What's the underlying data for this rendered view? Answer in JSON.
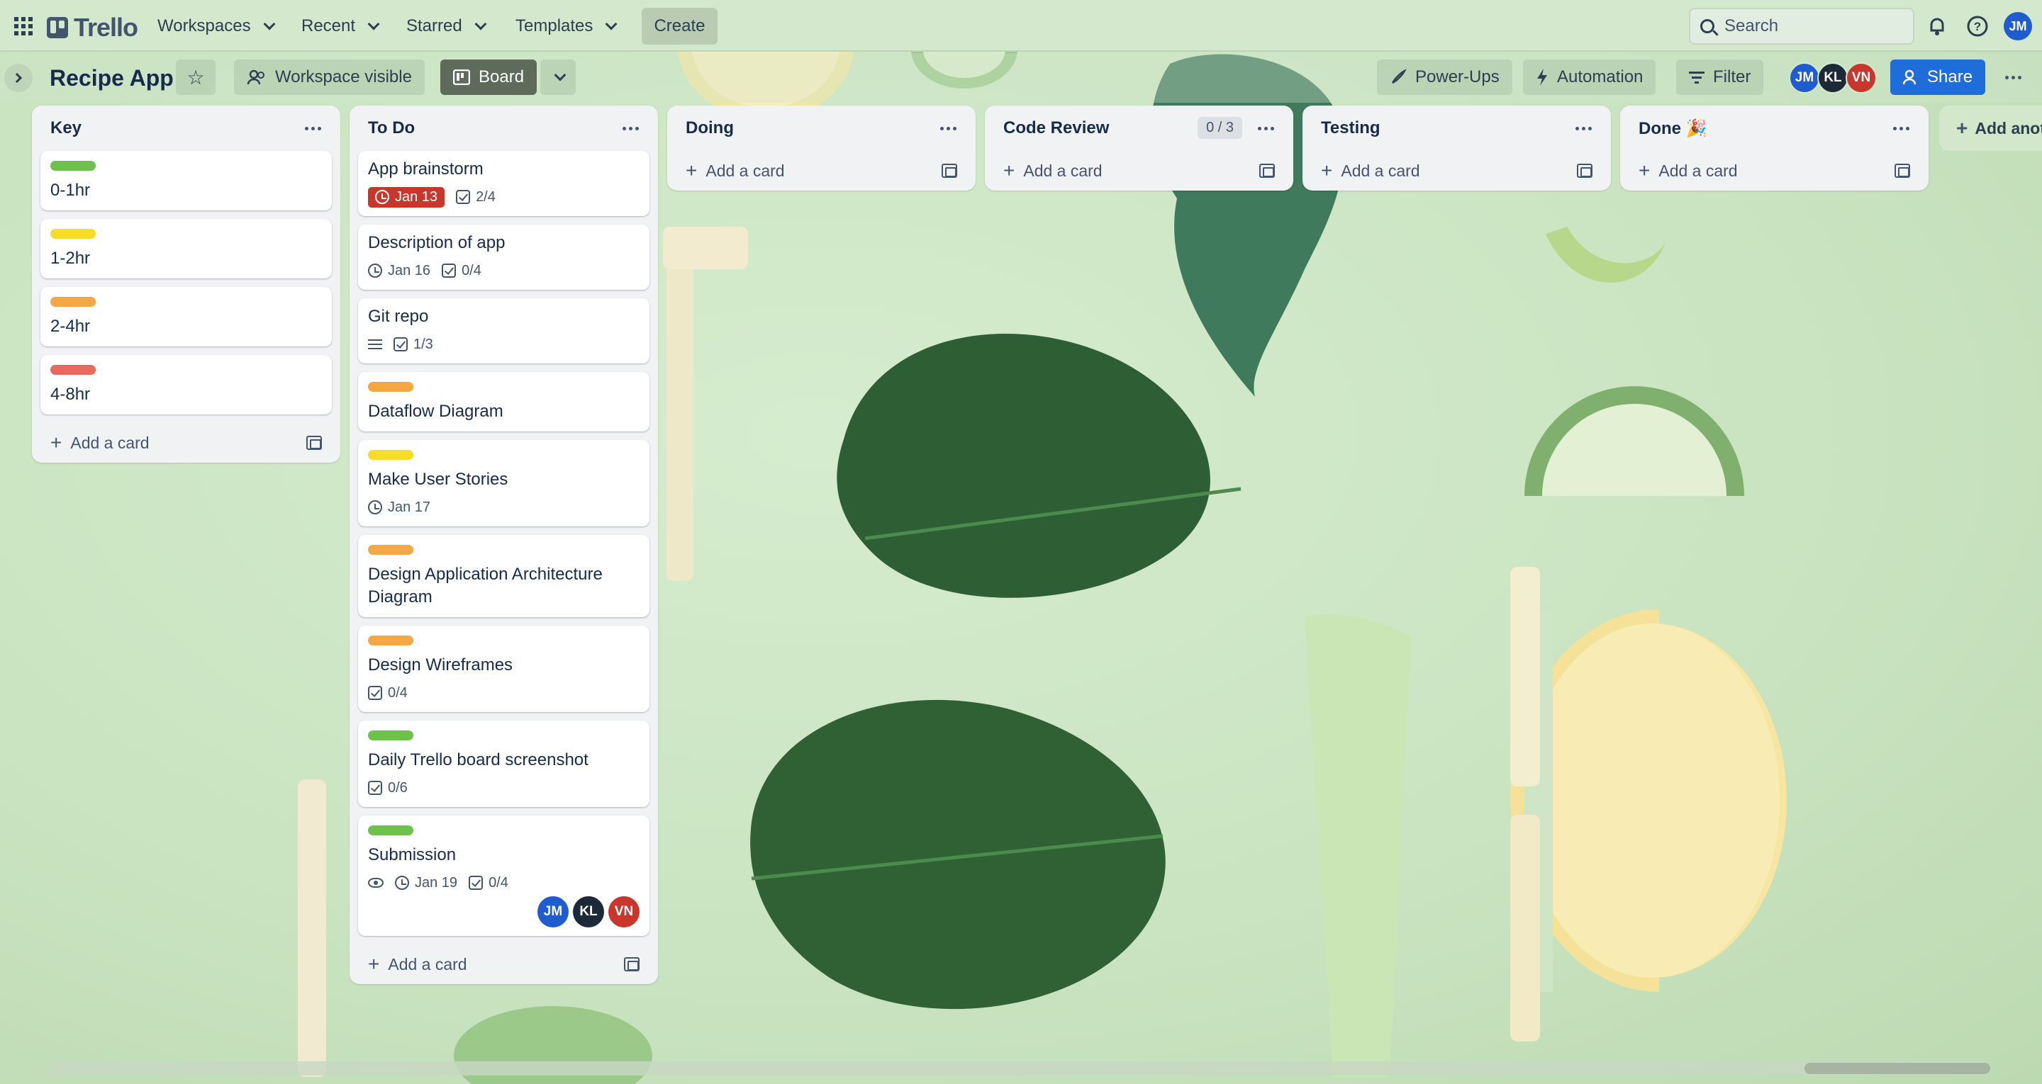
{
  "nav": {
    "logo": "Trello",
    "menus": [
      "Workspaces",
      "Recent",
      "Starred",
      "Templates"
    ],
    "create": "Create",
    "search_placeholder": "Search",
    "user_initials": "JM"
  },
  "board": {
    "title": "Recipe App",
    "visibility": "Workspace visible",
    "view": "Board",
    "power_ups": "Power-Ups",
    "automation": "Automation",
    "filter": "Filter",
    "share": "Share",
    "members": [
      "JM",
      "KL",
      "VN"
    ]
  },
  "lists": [
    {
      "title": "Key",
      "cards": [
        {
          "label_color": "#6cc24a",
          "title": "0-1hr"
        },
        {
          "label_color": "#f5dd29",
          "title": "1-2hr"
        },
        {
          "label_color": "#f4a742",
          "title": "2-4hr"
        },
        {
          "label_color": "#e86a5e",
          "title": "4-8hr"
        }
      ],
      "add_card": "Add a card"
    },
    {
      "title": "To Do",
      "cards": [
        {
          "title": "App brainstorm",
          "due": "Jan 13",
          "due_overdue": true,
          "checklist": "2/4"
        },
        {
          "title": "Description of app",
          "due": "Jan 16",
          "checklist": "0/4"
        },
        {
          "title": "Git repo",
          "has_description": true,
          "checklist": "1/3"
        },
        {
          "label_color": "#f4a742",
          "title": "Dataflow Diagram"
        },
        {
          "label_color": "#f5dd29",
          "title": "Make User Stories",
          "due": "Jan 17"
        },
        {
          "label_color": "#f4a742",
          "title": "Design Application Architecture Diagram"
        },
        {
          "label_color": "#f4a742",
          "title": "Design Wireframes",
          "checklist": "0/4"
        },
        {
          "label_color": "#6cc24a",
          "title": "Daily Trello board screenshot",
          "checklist": "0/6"
        },
        {
          "label_color": "#6cc24a",
          "title": "Submission",
          "watching": true,
          "due": "Jan 19",
          "checklist": "0/4",
          "members": [
            "JM",
            "KL",
            "VN"
          ]
        }
      ],
      "add_card": "Add a card"
    },
    {
      "title": "Doing",
      "add_card": "Add a card"
    },
    {
      "title": "Code Review",
      "wip": "0 / 3",
      "add_card": "Add a card"
    },
    {
      "title": "Testing",
      "add_card": "Add a card"
    },
    {
      "title": "Done 🎉",
      "add_card": "Add a card"
    }
  ],
  "add_list": "Add another list"
}
